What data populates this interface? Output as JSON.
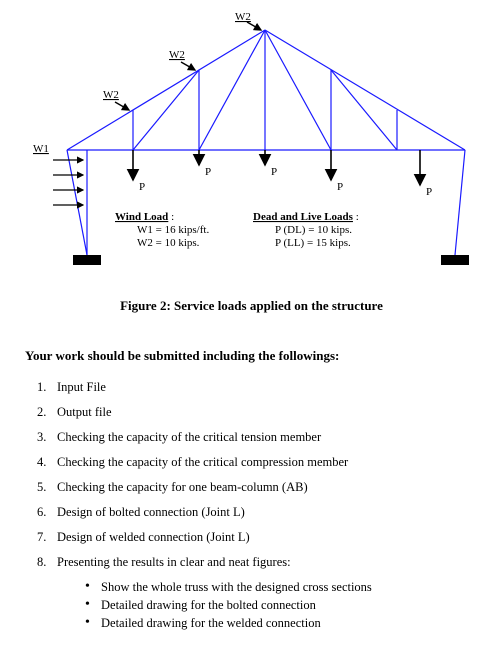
{
  "figure": {
    "labels": {
      "W1": "W1",
      "W2": "W2",
      "P": "P"
    },
    "wind_load": {
      "title": "Wind Load",
      "W1": "W1 = 16 kips/ft.",
      "W2": "W2 = 10 kips."
    },
    "dead_live_loads": {
      "title": "Dead and Live Loads",
      "DL": "P (DL) = 10 kips.",
      "LL": "P (LL) = 15 kips."
    },
    "caption": "Figure 2: Service loads applied on the structure"
  },
  "instructions": {
    "heading": "Your work should be submitted including the followings:",
    "items": [
      "Input File",
      "Output file",
      "Checking the capacity of the critical tension member",
      "Checking the capacity of the critical compression member",
      "Checking the capacity for one beam-column (AB)",
      "Design of bolted connection (Joint L)",
      "Design of welded connection (Joint L)",
      "Presenting the results in clear and neat figures:"
    ],
    "subitems": [
      "Show the whole truss with the designed cross sections",
      "Detailed drawing for the bolted connection",
      "Detailed drawing for the welded connection"
    ]
  }
}
